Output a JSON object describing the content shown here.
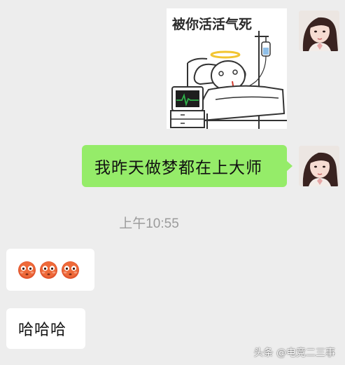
{
  "messages": {
    "sticker_caption": "被你活活气死",
    "sent_text": "我昨天做梦都在上大师",
    "timestamp": "上午10:55",
    "reply_emojis": [
      "flushed-face-emoji",
      "flushed-face-emoji",
      "flushed-face-emoji"
    ],
    "reply_text": "哈哈哈"
  },
  "watermark": "头条 @电竞二三事",
  "colors": {
    "background": "#ededed",
    "sent_bubble": "#95ec69",
    "received_bubble": "#ffffff",
    "timestamp_text": "#9b9b9b",
    "monitor_line": "#2fb24a"
  }
}
